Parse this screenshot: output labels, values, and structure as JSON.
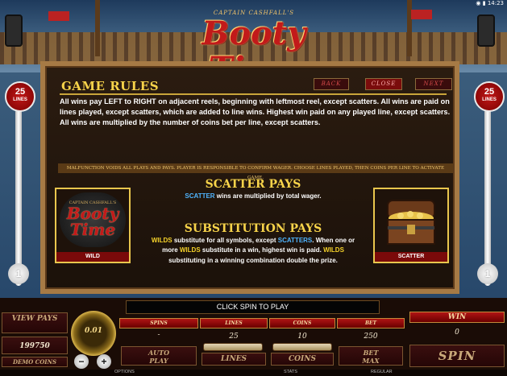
{
  "status_bar": {
    "time": "14:23"
  },
  "logo": {
    "sub": "CAPTAIN CASHFALL'S",
    "main": "Booty Time"
  },
  "side": {
    "lines_count": "25",
    "lines_word": "LINES",
    "left_bottom": "1",
    "right_bottom": "1"
  },
  "panel": {
    "title": "GAME RULES",
    "nav": {
      "back": "BACK",
      "close": "CLOSE",
      "next": "NEXT"
    },
    "rules": "All wins pay LEFT to RIGHT on adjacent reels, beginning with leftmost reel, except scatters. All wins are paid on lines played, except scatters, which are added to line wins. Highest win paid on any played line, except scatters. All wins are multiplied by the number of coins bet per line, except scatters.",
    "malfunction": "MALFUNCTION VOIDS ALL PLAYS AND PAYS. PLAYER IS RESPONSIBLE TO CONFIRM WAGER. CHOOSE LINES PLAYED, THEN COINS PER LINE TO ACTIVATE GAME.",
    "scatter_heading": "SCATTER PAYS",
    "scatter_word": "SCATTER",
    "scatter_text": " wins are multiplied by total wager.",
    "subst_heading": "SUBSTITUTION PAYS",
    "subst": {
      "w1": "WILDS",
      "t1": " substitute for all symbols, except ",
      "s1": "SCATTERS",
      "t2": ". When one or more ",
      "w2": "WILDS",
      "t3": " substitute in a win, highest win is paid. ",
      "w3": "WILDS",
      "t4": " substituting in a winning combination double the prize."
    },
    "wild_symbol": {
      "sub": "CAPTAIN CASHFALL'S",
      "main": "Booty Time",
      "label": "WILD"
    },
    "scatter_symbol": {
      "label": "SCATTER"
    }
  },
  "controls": {
    "message": "CLICK SPIN TO PLAY",
    "view_pays": "VIEW PAYS",
    "balance": "199750",
    "demo_coins": "DEMO COINS",
    "coin_size": "0.01",
    "minus": "−",
    "plus": "+",
    "spins_label": "SPINS",
    "spins_value": "-",
    "auto_play": "AUTO PLAY",
    "lines_label": "LINES",
    "lines_value": "25",
    "lines_btn": "LINES",
    "coins_label": "COINS",
    "coins_value": "10",
    "coins_btn": "COINS",
    "bet_label": "BET",
    "bet_value": "250",
    "bet_max": "BET MAX",
    "win_label": "WIN",
    "win_value": "0",
    "spin": "SPIN"
  },
  "footer": {
    "options": "OPTIONS",
    "stats": "STATS",
    "regular": "REGULAR"
  }
}
